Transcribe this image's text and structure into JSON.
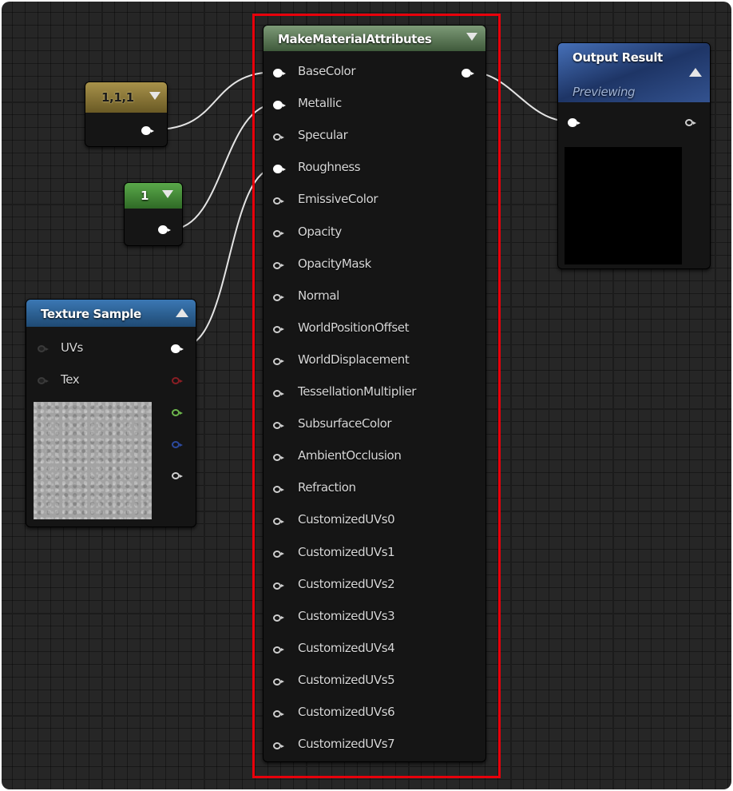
{
  "nodes": {
    "constant3": {
      "value": "1,1,1",
      "color": "#7a6a2e"
    },
    "constant": {
      "value": "1",
      "color": "#3f7a32"
    },
    "texture_sample": {
      "title": "Texture Sample",
      "header_color": "#2c5a8a",
      "inputs": [
        "UVs",
        "Tex"
      ]
    },
    "make_material_attributes": {
      "title": "MakeMaterialAttributes",
      "header_color": "#5b7656",
      "pins": [
        "BaseColor",
        "Metallic",
        "Specular",
        "Roughness",
        "EmissiveColor",
        "Opacity",
        "OpacityMask",
        "Normal",
        "WorldPositionOffset",
        "WorldDisplacement",
        "TessellationMultiplier",
        "SubsurfaceColor",
        "AmbientOcclusion",
        "Refraction",
        "CustomizedUVs0",
        "CustomizedUVs1",
        "CustomizedUVs2",
        "CustomizedUVs3",
        "CustomizedUVs4",
        "CustomizedUVs5",
        "CustomizedUVs6",
        "CustomizedUVs7"
      ],
      "connected_pins": [
        "BaseColor",
        "Metallic",
        "Roughness"
      ]
    },
    "output_result": {
      "title": "Output Result",
      "subtitle": "Previewing",
      "header_color": "#2a4a86"
    }
  },
  "icons": [
    "collapse-arrow-icon",
    "expand-arrow-icon",
    "pin-icon"
  ],
  "colors": {
    "graph_background": "#262626",
    "highlight_box": "#e8000b",
    "wire": "#e0e0e0"
  }
}
